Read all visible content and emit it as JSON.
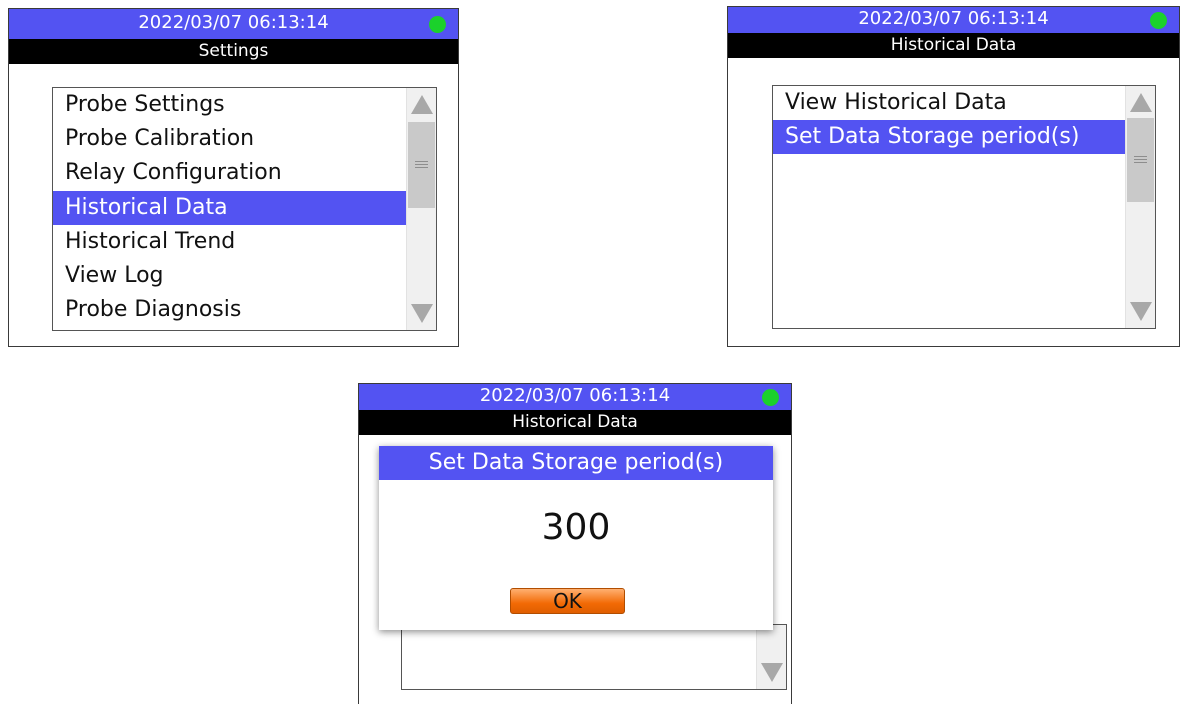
{
  "colors": {
    "accent": "#5353f2",
    "title_bar": "#000000",
    "status_led": "#1bd12b",
    "ok_button": "#f26a05"
  },
  "screen1": {
    "datetime": "2022/03/07 06:13:14",
    "title": "Settings",
    "menu": [
      {
        "label": "Probe Settings",
        "selected": false
      },
      {
        "label": "Probe Calibration",
        "selected": false
      },
      {
        "label": "Relay Configuration",
        "selected": false
      },
      {
        "label": "Historical Data",
        "selected": true
      },
      {
        "label": "Historical Trend",
        "selected": false
      },
      {
        "label": "View Log",
        "selected": false
      },
      {
        "label": "Probe Diagnosis",
        "selected": false
      }
    ]
  },
  "screen2": {
    "datetime": "2022/03/07 06:13:14",
    "title": "Historical Data",
    "menu": [
      {
        "label": "View Historical Data",
        "selected": false
      },
      {
        "label": "Set Data Storage period(s)",
        "selected": true
      }
    ]
  },
  "screen3": {
    "datetime": "2022/03/07 06:13:14",
    "title": "Historical Data",
    "dialog": {
      "title": "Set Data Storage period(s)",
      "value": "300",
      "ok_label": "OK"
    }
  }
}
